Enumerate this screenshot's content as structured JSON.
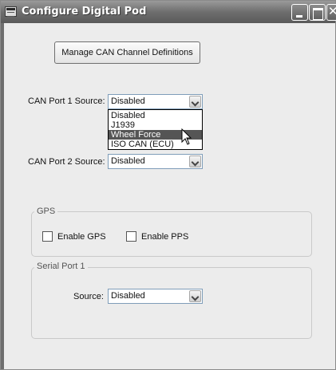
{
  "window": {
    "title": "Configure Digital Pod"
  },
  "buttons": {
    "manage_can": "Manage CAN Channel Definitions"
  },
  "can_port_1": {
    "label": "CAN Port 1 Source:",
    "value": "Disabled",
    "dropdown_open": true,
    "options": [
      "Disabled",
      "J1939",
      "Wheel Force",
      "ISO CAN (ECU)"
    ],
    "highlighted_option": "Wheel Force"
  },
  "can_port_2": {
    "label": "CAN Port 2 Source:",
    "value": "Disabled"
  },
  "gps": {
    "legend": "GPS",
    "enable_gps_label": "Enable GPS",
    "enable_gps_checked": false,
    "enable_pps_label": "Enable PPS",
    "enable_pps_checked": false
  },
  "serial_port_1": {
    "legend": "Serial Port 1",
    "source_label": "Source:",
    "source_value": "Disabled"
  },
  "icons": {
    "app": "app-window-icon",
    "minimize": "minimize-icon",
    "maximize": "maximize-icon",
    "close": "close-icon",
    "dropdown": "chevron-down-icon",
    "cursor": "mouse-pointer-icon"
  },
  "colors": {
    "titlebar": "#6e6e6e",
    "selection": "#555555",
    "window_bg": "#ececec"
  }
}
